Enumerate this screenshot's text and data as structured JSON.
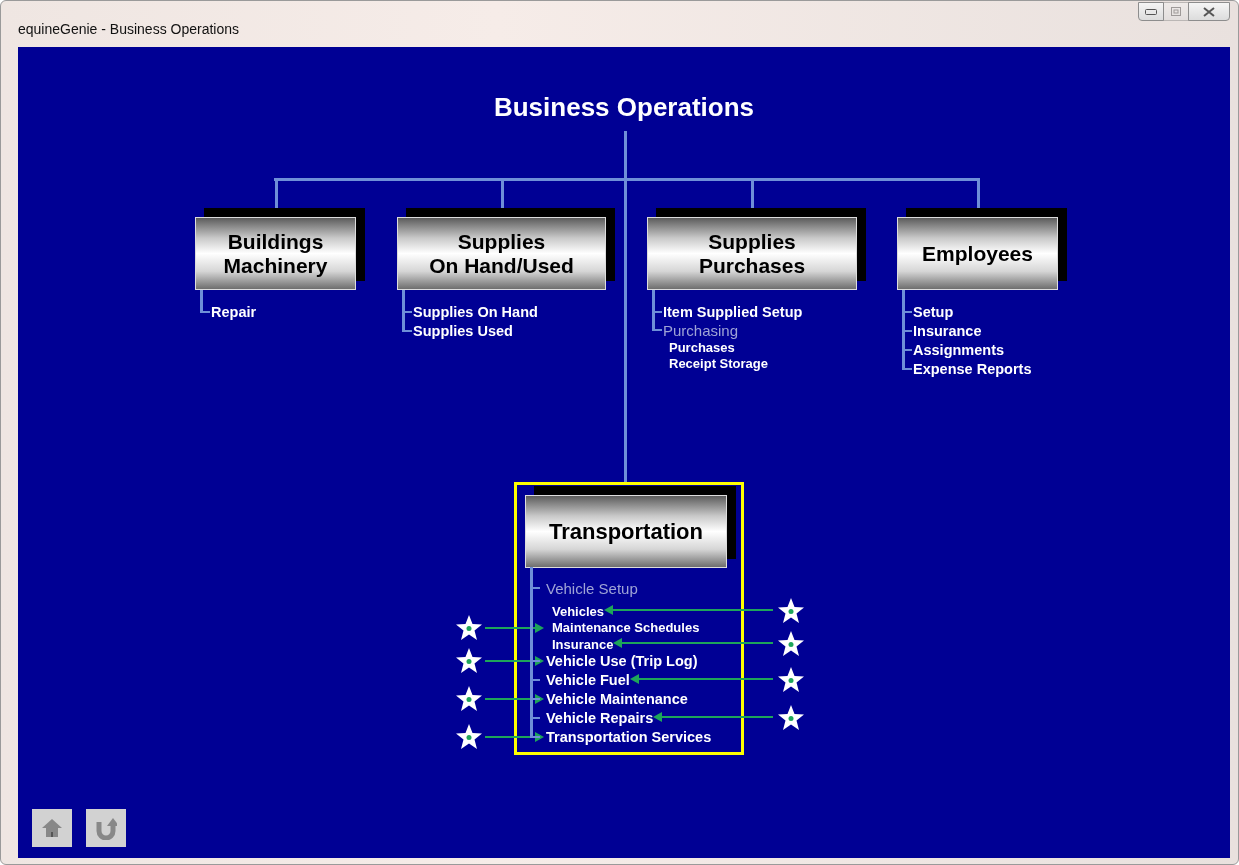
{
  "window": {
    "title": "equineGenie - Business Operations",
    "controls": [
      {
        "kind": "minimize",
        "disabled": false
      },
      {
        "kind": "maximize",
        "disabled": true
      },
      {
        "kind": "close",
        "disabled": false
      }
    ]
  },
  "heading": "Business Operations",
  "branches": [
    {
      "title": "Buildings\nMachinery",
      "items": [
        {
          "label": "Repair",
          "kind": "link"
        }
      ]
    },
    {
      "title": "Supplies\nOn Hand/Used",
      "items": [
        {
          "label": "Supplies On Hand",
          "kind": "link"
        },
        {
          "label": "Supplies Used",
          "kind": "link"
        }
      ]
    },
    {
      "title": "Supplies\nPurchases",
      "items": [
        {
          "label": "Item Supplied Setup",
          "kind": "link"
        },
        {
          "label": "Purchasing",
          "kind": "group"
        },
        {
          "label": "Purchases",
          "kind": "sub"
        },
        {
          "label": "Receipt Storage",
          "kind": "sub"
        }
      ]
    },
    {
      "title": "Employees",
      "items": [
        {
          "label": "Setup",
          "kind": "link"
        },
        {
          "label": "Insurance",
          "kind": "link"
        },
        {
          "label": "Assignments",
          "kind": "link"
        },
        {
          "label": "Expense Reports",
          "kind": "link"
        }
      ]
    }
  ],
  "focus": {
    "title": "Transportation",
    "highlighted": true,
    "items": [
      {
        "label": "Vehicle Setup",
        "kind": "group",
        "star_left": false,
        "star_right": false
      },
      {
        "label": "Vehicles",
        "kind": "sub",
        "star_left": false,
        "star_right": true
      },
      {
        "label": "Maintenance Schedules",
        "kind": "sub",
        "star_left": true,
        "star_right": false
      },
      {
        "label": "Insurance",
        "kind": "sub",
        "star_left": false,
        "star_right": true
      },
      {
        "label": "Vehicle Use (Trip Log)",
        "kind": "link",
        "star_left": true,
        "star_right": false
      },
      {
        "label": "Vehicle Fuel",
        "kind": "link",
        "star_left": false,
        "star_right": true
      },
      {
        "label": "Vehicle Maintenance",
        "kind": "link",
        "star_left": true,
        "star_right": false
      },
      {
        "label": "Vehicle Repairs",
        "kind": "link",
        "star_left": false,
        "star_right": true
      },
      {
        "label": "Transportation Services",
        "kind": "link",
        "star_left": true,
        "star_right": false
      }
    ]
  },
  "nav_buttons": [
    {
      "kind": "home"
    },
    {
      "kind": "back"
    }
  ]
}
